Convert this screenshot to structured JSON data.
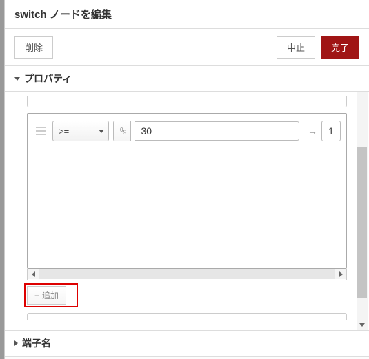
{
  "header": {
    "title": "switch ノードを編集"
  },
  "toolbar": {
    "delete_label": "削除",
    "cancel_label": "中止",
    "done_label": "完了"
  },
  "sections": {
    "properties": {
      "label": "プロパティ",
      "expanded": true
    },
    "ports": {
      "label": "端子名",
      "expanded": false
    }
  },
  "rule": {
    "operator": ">=",
    "type_hint": "0₉",
    "value": "30",
    "output_index": "1",
    "output_arrow": "→"
  },
  "add_button": {
    "label": "追加",
    "plus": "+"
  }
}
